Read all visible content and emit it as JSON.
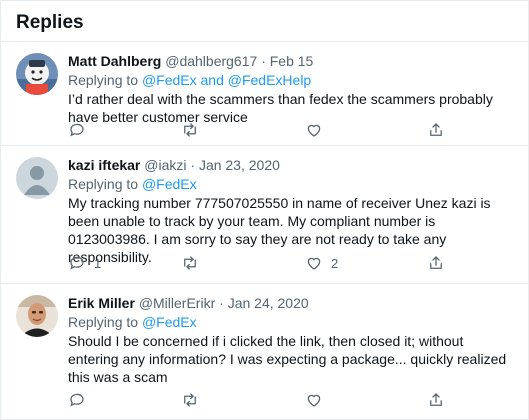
{
  "header": {
    "title": "Replies"
  },
  "replies": [
    {
      "name": "Matt Dahlberg",
      "handle": "@dahlberg617",
      "sep": "·",
      "date": "Feb 15",
      "replying_prefix": "Replying to",
      "replying_targets": "@FedEx and @FedExHelp",
      "text": "I’d rather deal with the scammers than fedex the scammers probably have better customer service",
      "reply_count": "",
      "like_count": ""
    },
    {
      "name": "kazi iftekar",
      "handle": "@iakzi",
      "sep": "·",
      "date": "Jan 23, 2020",
      "replying_prefix": "Replying to",
      "replying_targets": "@FedEx",
      "text": "My tracking number 777507025550 in name of receiver Unez kazi is been unable to track by your team. My compliant number is 0123003986. I am sorry to say they are not ready to take any responsibility.",
      "reply_count": "1",
      "like_count": "2"
    },
    {
      "name": "Erik Miller",
      "handle": "@MillerErikr",
      "sep": "·",
      "date": "Jan 24, 2020",
      "replying_prefix": "Replying to",
      "replying_targets": "@FedEx",
      "text": "Should I be concerned if i clicked the link, then closed it; without entering any information? I was expecting a package... quickly realized this was a scam",
      "reply_count": "",
      "like_count": ""
    }
  ],
  "icons": {
    "reply": "reply-icon",
    "retweet": "retweet-icon",
    "like": "heart-icon",
    "share": "share-icon"
  },
  "colors": {
    "link": "#1d9bf0",
    "secondary_text": "#536471",
    "divider": "#e6ecf0"
  }
}
